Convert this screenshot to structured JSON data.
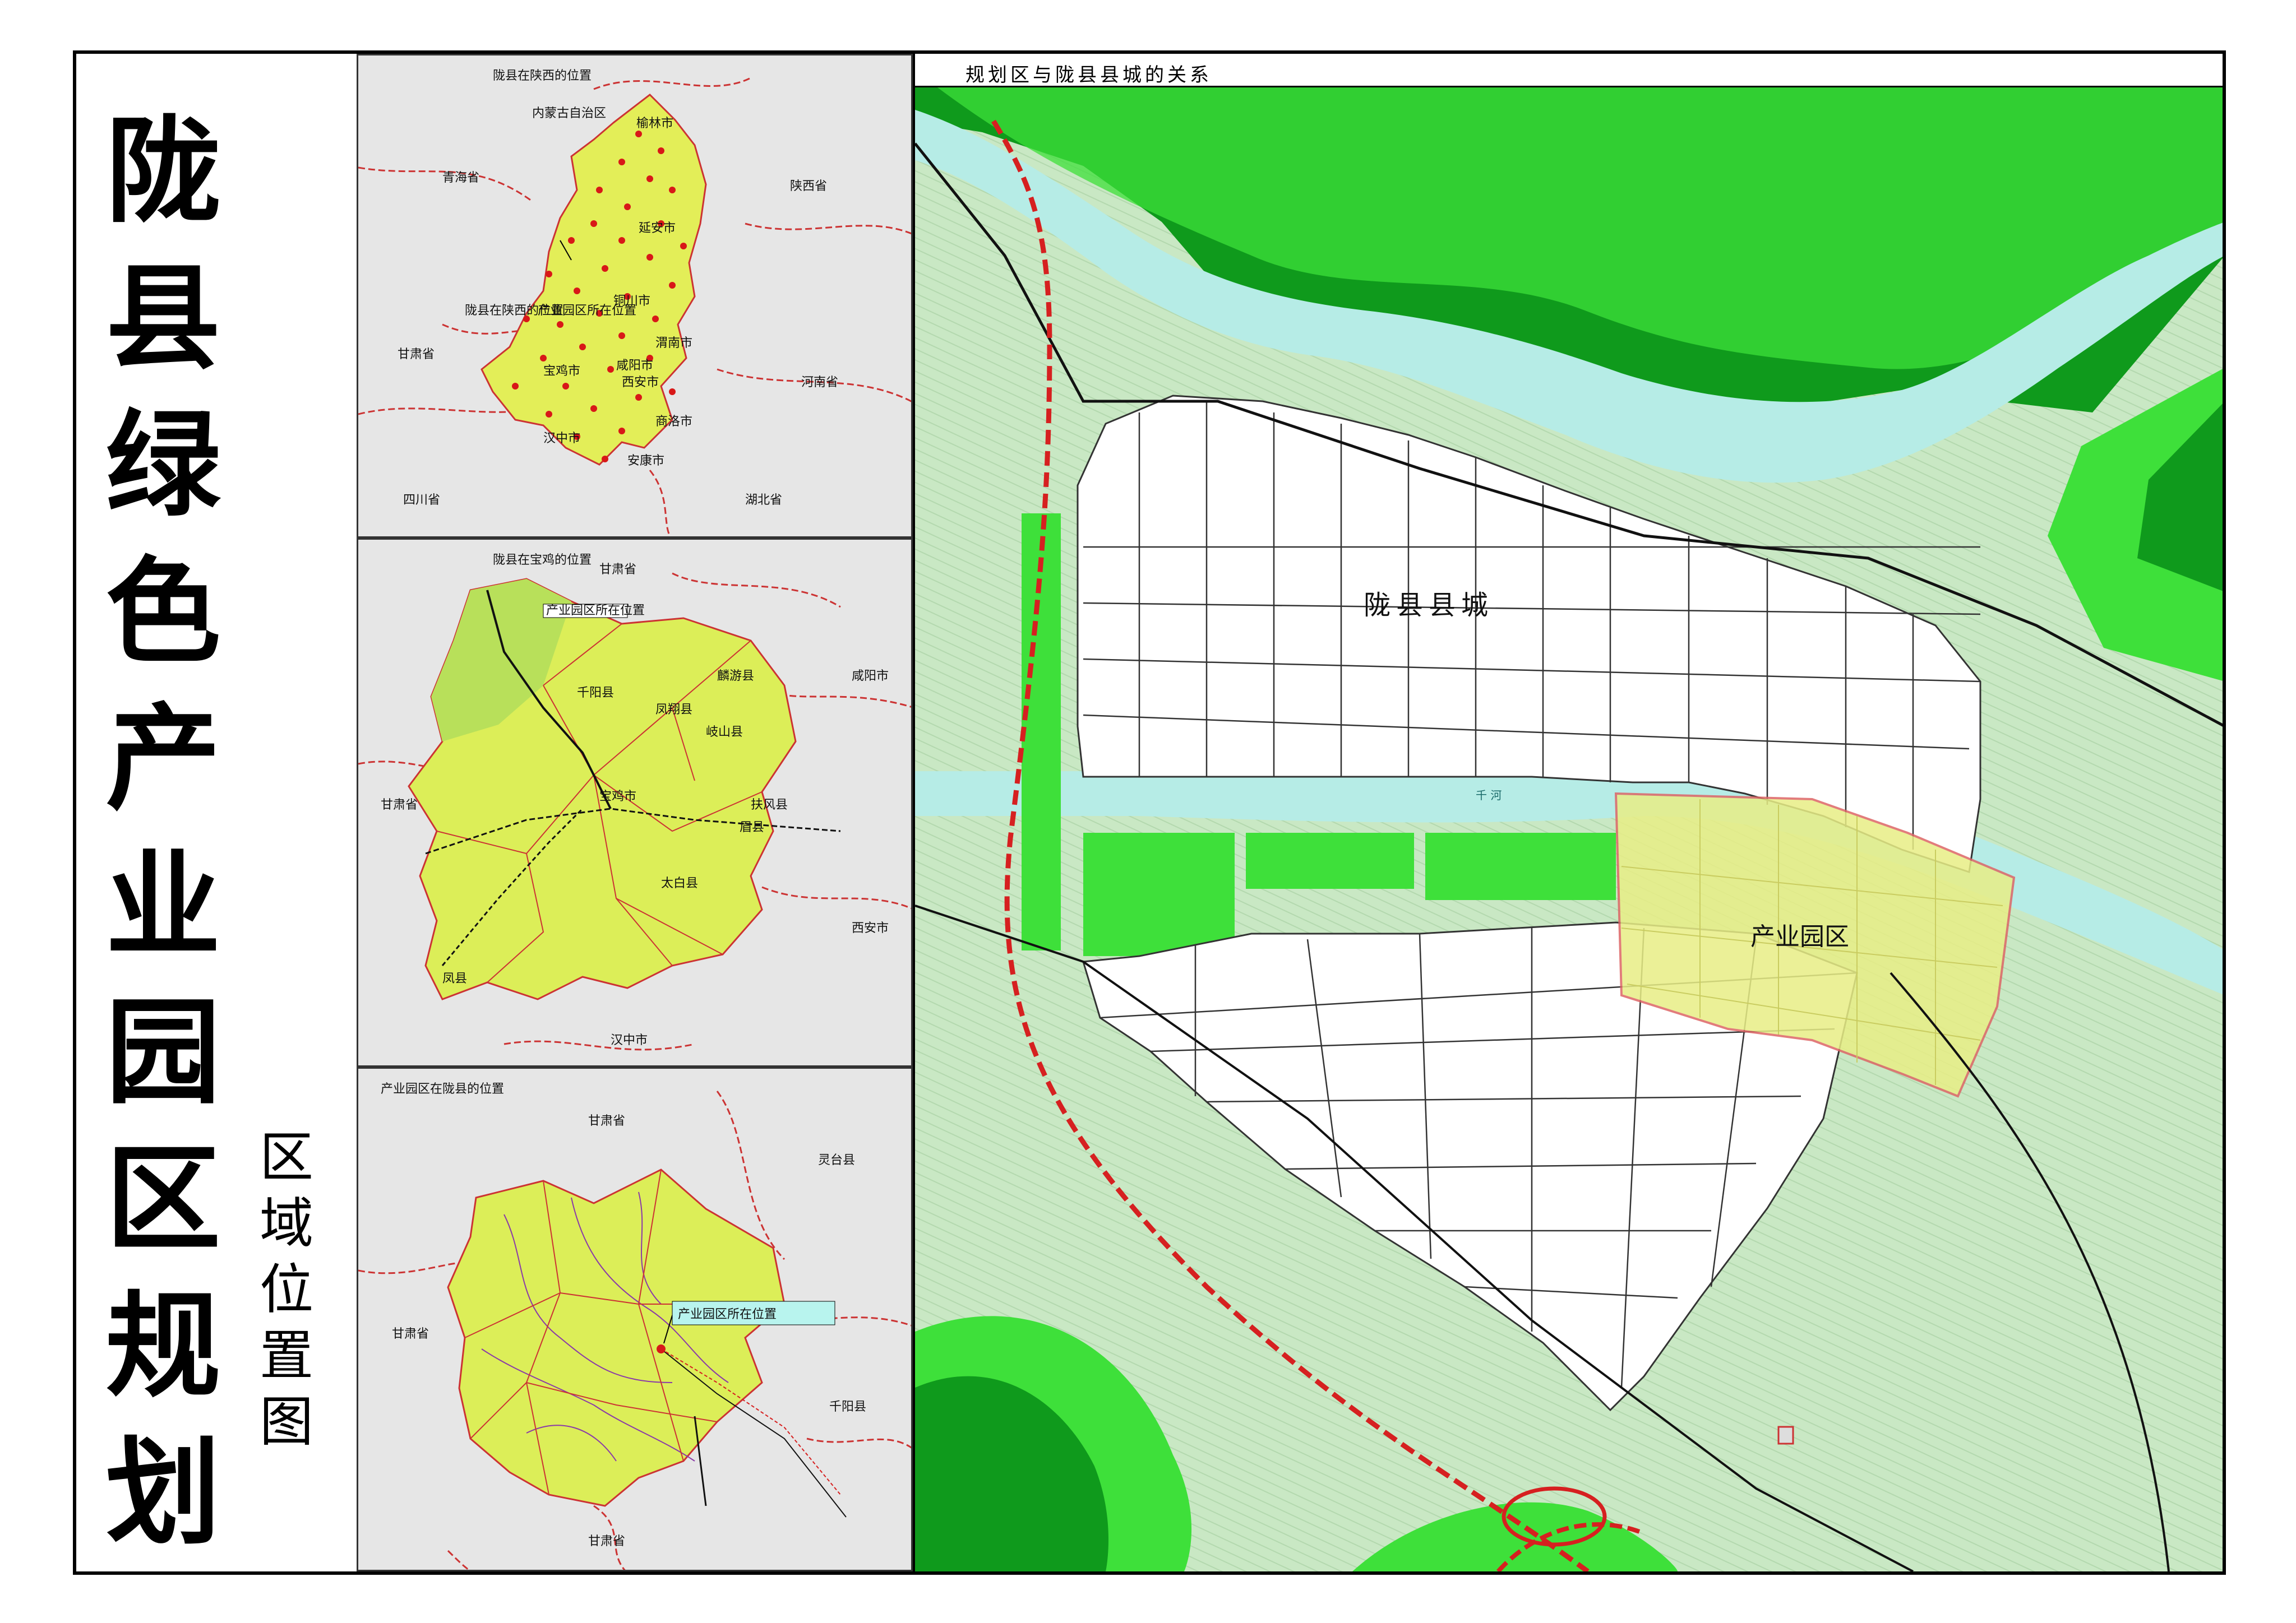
{
  "main_title": [
    "陇",
    "县",
    "绿",
    "色",
    "产",
    "业",
    "园",
    "区",
    "规",
    "划"
  ],
  "sub_title": [
    "区",
    "域",
    "位",
    "置",
    "图"
  ],
  "panel1": {
    "title": "陇县在陕西的位置",
    "labels": {
      "inner_mongolia": "内蒙古自治区",
      "qinghai": "青海省",
      "shaanxi": "陕西省",
      "gansu": "甘肃省",
      "henan": "河南省",
      "sichuan": "四川省",
      "hubei": "湖北省",
      "yulin": "榆林市",
      "yanan": "延安市",
      "tongchuan": "铜川市",
      "weinan": "渭南市",
      "xianyang": "咸阳市",
      "xian": "西安市",
      "baoji": "宝鸡市",
      "hanzhong": "汉中市",
      "ankang": "安康市",
      "shangluo": "商洛市",
      "longxian_marker": "陇县在陕西的位置",
      "park_marker": "产业园区所在位置"
    }
  },
  "panel2": {
    "title": "陇县在宝鸡的位置",
    "labels": {
      "gansu_top": "甘肃省",
      "gansu_left": "甘肃省",
      "xianyang": "咸阳市",
      "xian": "西安市",
      "hanzhong": "汉中市",
      "park_marker": "产业园区所在位置",
      "qianyang": "千阳县",
      "fengxiang": "凤翔县",
      "linyou": "麟游县",
      "qishan": "岐山县",
      "fufeng": "扶风县",
      "baoji": "宝鸡市",
      "meixian": "眉县",
      "taibai": "太白县",
      "fengxian": "凤县"
    }
  },
  "panel3": {
    "title": "产业园区在陇县的位置",
    "labels": {
      "gansu_top": "甘肃省",
      "gansu_left": "甘肃省",
      "gansu_bottom": "甘肃省",
      "lingtai": "灵台县",
      "qianyang": "千阳县",
      "park_marker": "产业园区所在位置"
    }
  },
  "big_map": {
    "title": "规划区与陇县县城的关系",
    "town_label": "陇县县城",
    "park_label": "产业园区",
    "river_label": "千 河"
  },
  "colors": {
    "mountain_dark": "#0f9a1c",
    "mountain_light": "#3ee03a",
    "farmland": "#c9e8c4",
    "river": "#b6ece6",
    "park": "#e8ee86",
    "province_fill": "#e3ee58",
    "rail": "#d62020"
  }
}
